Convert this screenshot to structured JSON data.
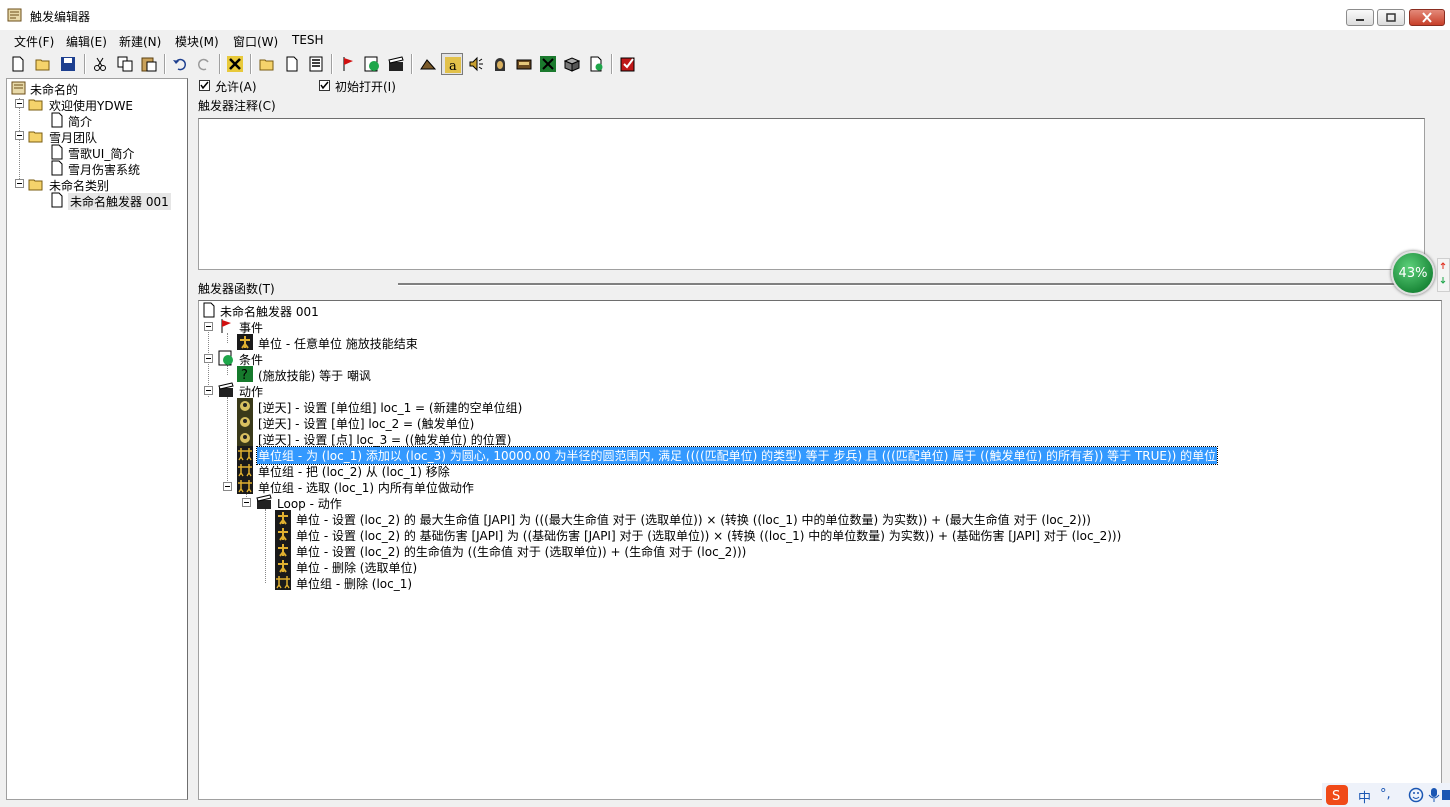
{
  "window": {
    "title": "触发编辑器"
  },
  "menu": [
    "文件(F)",
    "编辑(E)",
    "新建(N)",
    "模块(M)",
    "窗口(W)",
    "TESH"
  ],
  "toolbar": {
    "buttons": [
      "new-doc",
      "open-folder",
      "save",
      "cut",
      "copy",
      "paste",
      "undo",
      "redo",
      "close-x",
      "new-category",
      "new-trigger",
      "new-comment",
      "new-event",
      "new-condition",
      "new-action",
      "terrain",
      "text-a",
      "sound",
      "unit-hood",
      "object-editor",
      "module-green",
      "object-box",
      "import"
    ],
    "pressed": "text-a"
  },
  "left_tree": {
    "root": "未命名的",
    "folders": [
      {
        "label": "欢迎使用YDWE",
        "items": [
          "简介"
        ]
      },
      {
        "label": "雪月团队",
        "items": [
          "雪歌UI_简介",
          "雪月伤害系统"
        ]
      },
      {
        "label": "未命名类别",
        "items": [
          "未命名触发器 001"
        ]
      }
    ]
  },
  "options": {
    "enabled_label": "允许(A)",
    "enabled": true,
    "initially_on_label": "初始打开(I)",
    "initially_on": true
  },
  "comment": {
    "label": "触发器注释(C)",
    "value": ""
  },
  "functions": {
    "label": "触发器函数(T)",
    "trigger_name": "未命名触发器 001",
    "events_label": "事件",
    "events": [
      "单位 - 任意单位 施放技能结束"
    ],
    "conditions_label": "条件",
    "conditions": [
      "(施放技能) 等于 嘲讽"
    ],
    "actions_label": "动作",
    "actions": [
      "[逆天] - 设置 [单位组] loc_1 = (新建的空单位组)",
      "[逆天] - 设置 [单位] loc_2 = (触发单位)",
      "[逆天] - 设置 [点] loc_3 = ((触发单位) 的位置)",
      "单位组 - 为 (loc_1) 添加以 (loc_3) 为圆心, 10000.00 为半径的圆范围内, 满足 ((((匹配单位) 的类型) 等于 步兵) 且 (((匹配单位) 属于 ((触发单位) 的所有者)) 等于 TRUE)) 的单位",
      "单位组 - 把 (loc_2) 从 (loc_1) 移除",
      "单位组 - 选取 (loc_1) 内所有单位做动作"
    ],
    "loop_label": "Loop - 动作",
    "loop_actions": [
      "单位 - 设置 (loc_2) 的 最大生命值 [JAPI] 为 (((最大生命值 对于 (选取单位)) × (转换 ((loc_1) 中的单位数量) 为实数)) + (最大生命值 对于 (loc_2)))",
      "单位 - 设置 (loc_2) 的 基础伤害 [JAPI] 为 ((基础伤害 [JAPI] 对于 (选取单位)) × (转换 ((loc_1) 中的单位数量) 为实数)) + (基础伤害 [JAPI] 对于 (loc_2)))",
      "单位 - 设置 (loc_2) 的生命值为 ((生命值 对于 (选取单位)) + (生命值 对于 (loc_2)))",
      "单位 - 删除 (选取单位)",
      "单位组 - 删除 (loc_1)"
    ],
    "selected_action_index": 3
  },
  "overlay": {
    "speed_value": "43%"
  },
  "tray": {
    "ime_label": "中",
    "punct": "°,"
  }
}
